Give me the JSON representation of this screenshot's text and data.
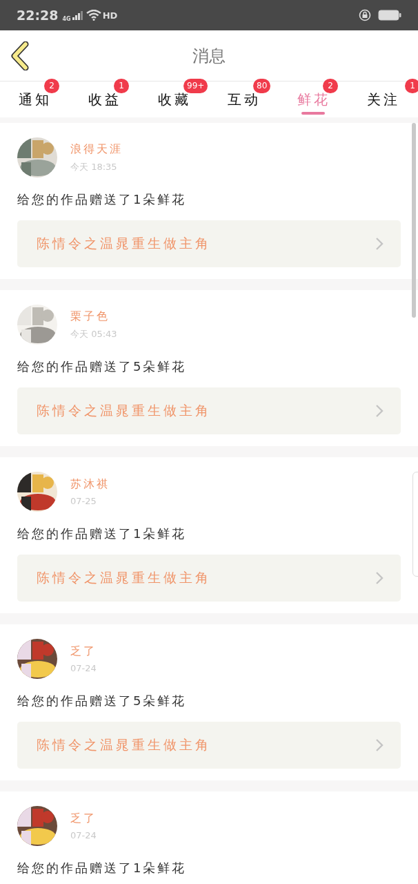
{
  "status_bar": {
    "time": "22:28",
    "network": "4G",
    "call": "HD"
  },
  "header": {
    "title": "消息"
  },
  "tabs": [
    {
      "label": "通知",
      "badge": "2",
      "selected": false
    },
    {
      "label": "收益",
      "badge": "1",
      "selected": false
    },
    {
      "label": "收藏",
      "badge": "99+",
      "selected": false
    },
    {
      "label": "互动",
      "badge": "80",
      "selected": false
    },
    {
      "label": "鲜花",
      "badge": "2",
      "selected": true
    },
    {
      "label": "关注",
      "badge": "1",
      "selected": false
    }
  ],
  "messages": [
    {
      "user": "浪得天涯",
      "time": "今天 18:35",
      "text": "给您的作品赠送了1朵鲜花",
      "work": "陈情令之温晁重生做主角"
    },
    {
      "user": "栗子色",
      "time": "今天 05:43",
      "text": "给您的作品赠送了5朵鲜花",
      "work": "陈情令之温晁重生做主角"
    },
    {
      "user": "苏沐祺",
      "time": "07-25",
      "text": "给您的作品赠送了1朵鲜花",
      "work": "陈情令之温晁重生做主角"
    },
    {
      "user": "乏了",
      "time": "07-24",
      "text": "给您的作品赠送了5朵鲜花",
      "work": "陈情令之温晁重生做主角"
    },
    {
      "user": "乏了",
      "time": "07-24",
      "text": "给您的作品赠送了1朵鲜花"
    }
  ]
}
